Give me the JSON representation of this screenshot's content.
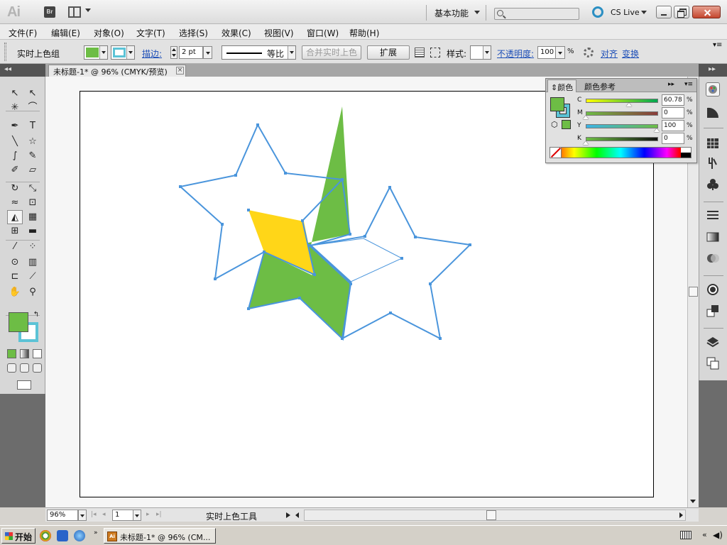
{
  "app": {
    "logo": "Ai",
    "bridge_label": "Br",
    "workspace": "基本功能",
    "cs_live": "CS Live"
  },
  "menu": [
    {
      "label": "文件(F)"
    },
    {
      "label": "编辑(E)"
    },
    {
      "label": "对象(O)"
    },
    {
      "label": "文字(T)"
    },
    {
      "label": "选择(S)"
    },
    {
      "label": "效果(C)"
    },
    {
      "label": "视图(V)"
    },
    {
      "label": "窗口(W)"
    },
    {
      "label": "帮助(H)"
    }
  ],
  "control_bar": {
    "selection_label": "实时上色组",
    "stroke_label": "描边:",
    "stroke_weight": "2 pt",
    "stroke_profile": "等比",
    "merge_button": "合并实时上色",
    "expand_button": "扩展",
    "style_label": "样式:",
    "opacity_label": "不透明度:",
    "opacity_value": "100",
    "opacity_unit": "%",
    "align_label": "对齐",
    "transform_label": "变换",
    "fill_color": "#6dbd45",
    "stroke_color": "#5cc3d6"
  },
  "document": {
    "tab_title": "未标题-1* @ 96% (CMYK/预览)",
    "tab_close": "×"
  },
  "artwork": {
    "star_outline_color": "#4a95dc",
    "green_fill": "#6dbd45",
    "yellow_fill": "#ffd618"
  },
  "color_panel": {
    "tab_active": "颜色",
    "tab_other": "颜色参考",
    "expand_glyph": "▸▸",
    "menu_glyph": "▾≡",
    "fill": "#6dbd45",
    "stroke": "#5cc3d6",
    "channels": [
      {
        "name": "C",
        "value": "60.78",
        "fraction": 0.6078,
        "gradient": "linear-gradient(to right,#ffff00,#00a651)"
      },
      {
        "name": "M",
        "value": "0",
        "fraction": 0,
        "gradient": "linear-gradient(to right,#6dbd45,#8b3a3a)"
      },
      {
        "name": "Y",
        "value": "100",
        "fraction": 1,
        "gradient": "linear-gradient(to right,#3bb3e6,#6dbd45)"
      },
      {
        "name": "K",
        "value": "0",
        "fraction": 0,
        "gradient": "linear-gradient(to right,#6dbd45,#111)"
      }
    ],
    "unit": "%"
  },
  "status_bar": {
    "zoom": "96%",
    "artboard_number": "1",
    "current_tool": "实时上色工具"
  },
  "taskbar": {
    "start_label": "开始",
    "task_label": "未标题-1* @ 96% (CM...",
    "task_icon_label": "Ai"
  },
  "tools": [
    {
      "name": "selection-tool",
      "glyph": "↖"
    },
    {
      "name": "direct-selection-tool",
      "glyph": "↖"
    },
    {
      "name": "magic-wand-tool",
      "glyph": "✳"
    },
    {
      "name": "lasso-tool",
      "glyph": "⌒"
    },
    {
      "name": "pen-tool",
      "glyph": "✒"
    },
    {
      "name": "type-tool",
      "glyph": "T"
    },
    {
      "name": "line-segment-tool",
      "glyph": "╲"
    },
    {
      "name": "star-tool",
      "glyph": "☆"
    },
    {
      "name": "paintbrush-tool",
      "glyph": "∫"
    },
    {
      "name": "pencil-tool",
      "glyph": "✎"
    },
    {
      "name": "blob-brush-tool",
      "glyph": "✐"
    },
    {
      "name": "eraser-tool",
      "glyph": "▱"
    },
    {
      "name": "rotate-tool",
      "glyph": "↻"
    },
    {
      "name": "scale-tool",
      "glyph": "⤡"
    },
    {
      "name": "warp-tool",
      "glyph": "≈"
    },
    {
      "name": "free-transform-tool",
      "glyph": "⊡"
    },
    {
      "name": "live-paint-bucket-tool",
      "glyph": "◭"
    },
    {
      "name": "perspective-grid-tool",
      "glyph": "▦"
    },
    {
      "name": "mesh-tool",
      "glyph": "⊞"
    },
    {
      "name": "gradient-tool",
      "glyph": "▬"
    },
    {
      "name": "eyedropper-tool",
      "glyph": "⁄"
    },
    {
      "name": "blend-tool",
      "glyph": "⁘"
    },
    {
      "name": "symbol-sprayer-tool",
      "glyph": "⊙"
    },
    {
      "name": "column-graph-tool",
      "glyph": "▥"
    },
    {
      "name": "artboard-tool",
      "glyph": "⊏"
    },
    {
      "name": "slice-tool",
      "glyph": "⟋"
    },
    {
      "name": "hand-tool",
      "glyph": "✋"
    },
    {
      "name": "zoom-tool",
      "glyph": "⚲"
    }
  ]
}
